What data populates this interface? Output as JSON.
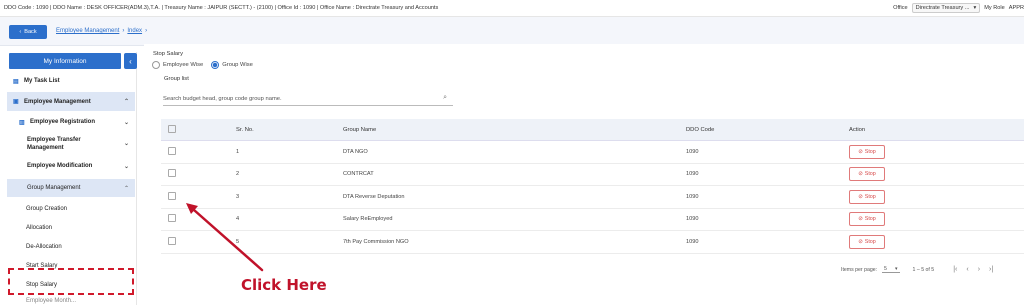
{
  "topbar": {
    "info": "DDO Code : 1090 | DDO Name : DESK OFFICER(ADM.3),T.A. | Treasury Name : JAIPUR (SECTT.) - (2100) | Office Id : 1090 | Office Name : Directrate Treasury and Accounts",
    "office_label": "Office",
    "office_value": "Directrate Treasury ...",
    "office_caret": "▾",
    "role_label": "My Role",
    "role_value": "APPR"
  },
  "nav": {
    "back_label": "Back",
    "back_icon": "‹",
    "breadcrumb": [
      "Employee Management",
      "Index"
    ],
    "sep": "›"
  },
  "sidebar": {
    "my_information": "My Information",
    "collapse_icon": "‹",
    "my_task_list": "My Task List",
    "employee_management": "Employee Management",
    "employee_registration": "Employee Registration",
    "employee_transfer_management_1": "Employee Transfer",
    "employee_transfer_management_2": "Management",
    "employee_modification": "Employee Modification",
    "group_management": "Group Management",
    "group_creation": "Group Creation",
    "allocation": "Allocation",
    "de_allocation": "De-Allocation",
    "start_salary": "Start Salary",
    "stop_salary": "Stop Salary",
    "cut_off": "Employee Month..."
  },
  "main": {
    "title": "Stop Salary",
    "radio_employee": "Employee Wise",
    "radio_group": "Group Wise",
    "group_list": "Group list",
    "search_placeholder": "Search budget head, group code group name.",
    "headers": {
      "sr": "Sr. No.",
      "group": "Group Name",
      "ddo": "DDO Code",
      "action": "Action"
    },
    "rows": [
      {
        "sr": "1",
        "group": "DTA NGO",
        "ddo": "1090",
        "action": "Stop"
      },
      {
        "sr": "2",
        "group": "CONTRCAT",
        "ddo": "1090",
        "action": "Stop"
      },
      {
        "sr": "3",
        "group": "DTA Reverse Deputation",
        "ddo": "1090",
        "action": "Stop"
      },
      {
        "sr": "4",
        "group": "Salary ReEmployed",
        "ddo": "1090",
        "action": "Stop"
      },
      {
        "sr": "5",
        "group": "7th Pay Commission NGO",
        "ddo": "1090",
        "action": "Stop"
      }
    ],
    "pager": {
      "items_per_page_label": "Items per page:",
      "items_per_page": "5",
      "caret": "▾",
      "range": "1 – 5 of 5",
      "first": "|‹",
      "prev": "‹",
      "next": "›",
      "last": "›|"
    }
  },
  "annotation": {
    "text": "Click Here",
    "color": "#c0122a"
  },
  "colors": {
    "primary": "#2c6fcb",
    "stop": "#d74a4a"
  }
}
